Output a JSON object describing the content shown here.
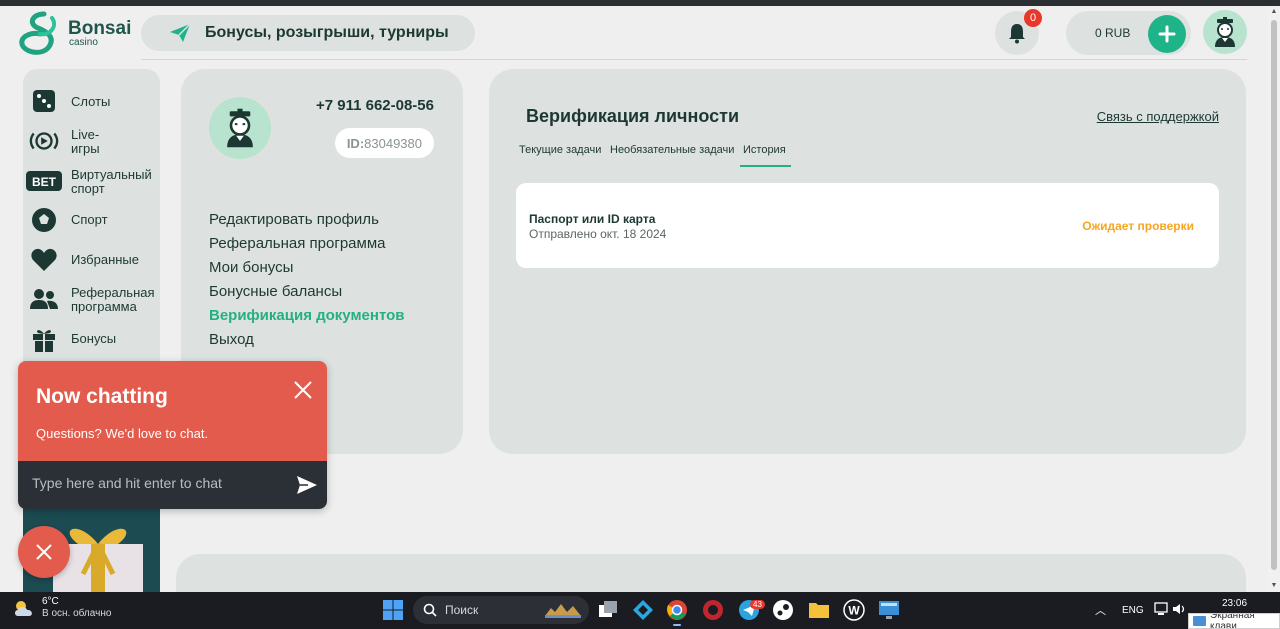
{
  "brand": {
    "name": "Bonsai",
    "sub": "casino"
  },
  "header": {
    "promo_label": "Бонусы, розыгрыши, турниры",
    "notification_count": "0",
    "balance": "0 RUB"
  },
  "sidebar": {
    "items": [
      {
        "label": "Слоты",
        "icon": "dice-icon"
      },
      {
        "label": "Live-\nигры",
        "icon": "live-games-icon"
      },
      {
        "label": "Виртуальный\nспорт",
        "icon": "bet-icon"
      },
      {
        "label": "Спорт",
        "icon": "soccer-ball-icon"
      },
      {
        "label": "Избранные",
        "icon": "heart-icon"
      },
      {
        "label": "Реферальная\nпрограмма",
        "icon": "users-icon"
      },
      {
        "label": "Бонусы",
        "icon": "gift-icon"
      }
    ]
  },
  "profile": {
    "phone": "+7 911 662-08-56",
    "id_prefix": "ID:",
    "id_value": "83049380",
    "menu": [
      "Редактировать профиль",
      "Реферальная программа",
      "Мои бонусы",
      "Бонусные балансы",
      "Верификация документов",
      "Выход"
    ],
    "active_menu": "Верификация документов"
  },
  "verification": {
    "title": "Верификация личности",
    "support_link": "Связь с поддержкой",
    "tabs": [
      "Текущие задачи",
      "Необязательные задачи",
      "История"
    ],
    "active_tab": "История",
    "card": {
      "document": "Паспорт или ID карта",
      "sent": "Отправлено окт. 18 2024",
      "status": "Ожидает проверки"
    }
  },
  "chat": {
    "title": "Now chatting",
    "subtitle": "Questions? We'd love to chat.",
    "placeholder": "Type here and hit enter to chat"
  },
  "taskbar": {
    "weather_temp": "6°C",
    "weather_desc": "В осн. облачно",
    "search_label": "Поиск",
    "telegram_badge": "43",
    "lang": "ENG",
    "time": "23:06",
    "osk_tooltip": "Экранная клави"
  },
  "colors": {
    "accent": "#24b083",
    "panel": "#dde2e0",
    "status_pending": "#f5a623",
    "chat": "#e25b4c"
  }
}
